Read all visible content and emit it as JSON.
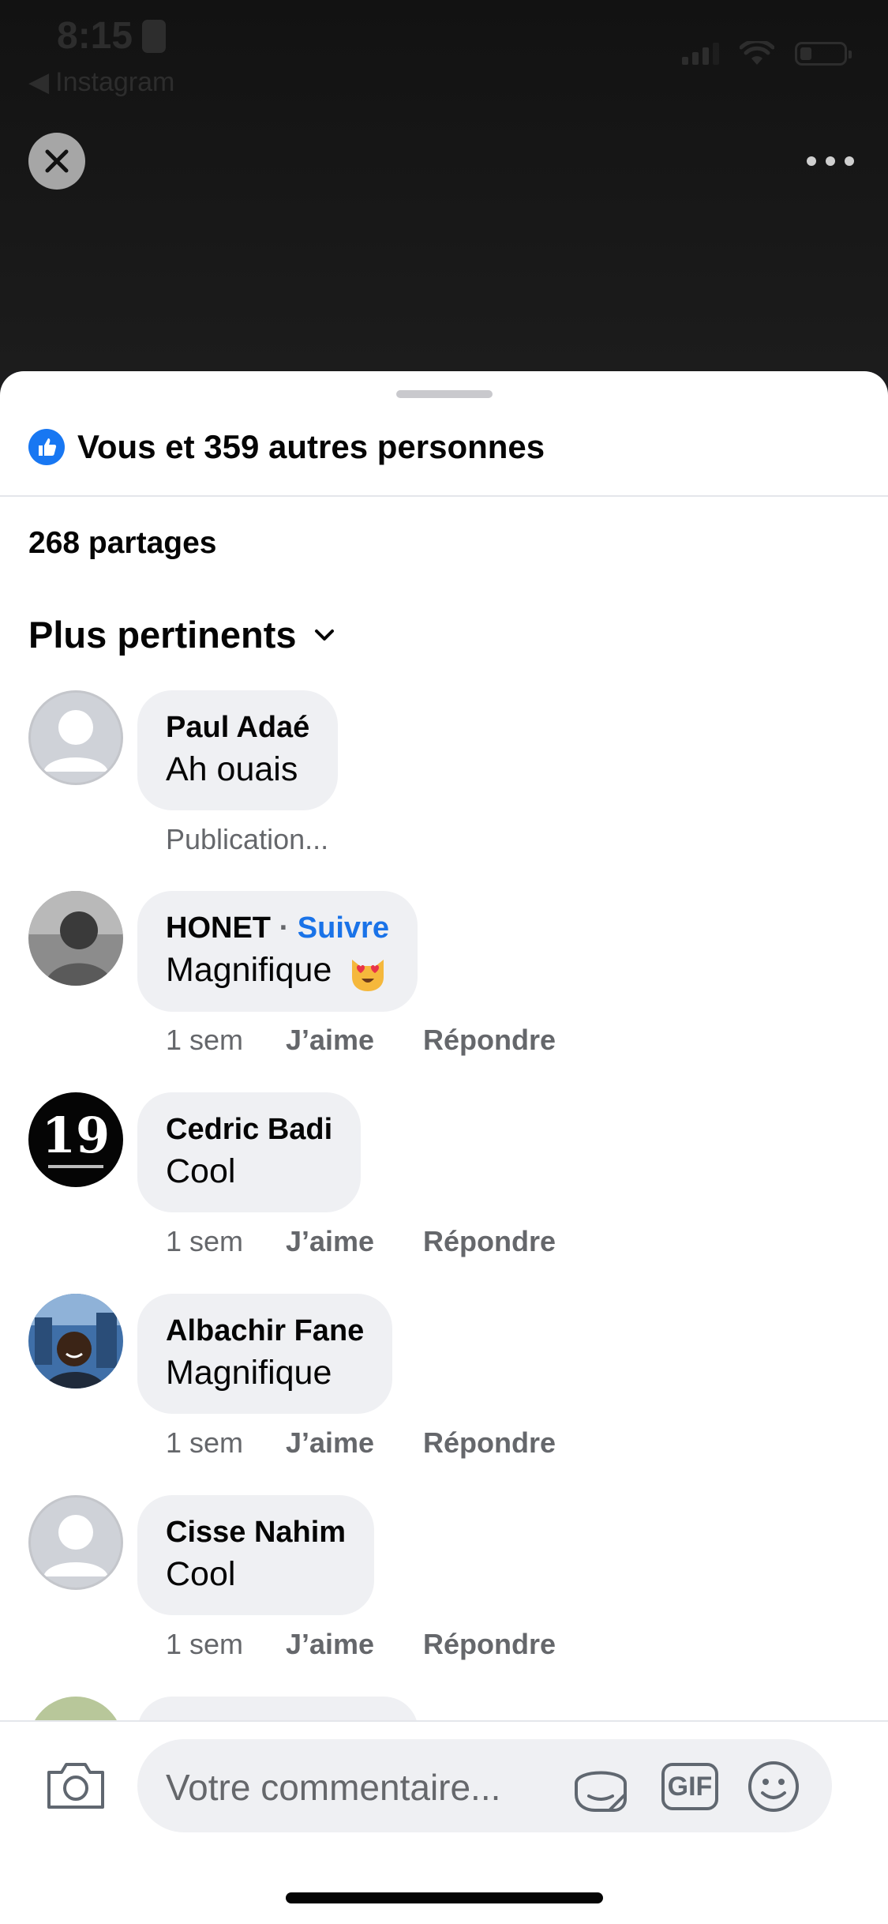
{
  "status_bar": {
    "time": "8:15",
    "back_app": "Instagram"
  },
  "top_bar": {
    "close_icon": "close-icon",
    "more_icon": "more-options-icon"
  },
  "sheet": {
    "reactions_text": "Vous et 359 autres personnes",
    "shares_text": "268 partages",
    "sort_label": "Plus pertinents"
  },
  "comments": [
    {
      "author": "Paul Adaé",
      "text": "Ah ouais",
      "status": "Publication..."
    },
    {
      "author": "HONET",
      "separator": "·",
      "follow": "Suivre",
      "text": "Magnifique",
      "time": "1 sem",
      "like": "J’aime",
      "reply": "Répondre"
    },
    {
      "author": "Cedric Badi",
      "text": "Cool",
      "avatar_text": "19",
      "time": "1 sem",
      "like": "J’aime",
      "reply": "Répondre"
    },
    {
      "author": "Albachir Fane",
      "text": "Magnifique",
      "time": "1 sem",
      "like": "J’aime",
      "reply": "Répondre"
    },
    {
      "author": "Cisse Nahim",
      "text": "Cool",
      "time": "1 sem",
      "like": "J’aime",
      "reply": "Répondre"
    }
  ],
  "input_bar": {
    "placeholder": "Votre commentaire...",
    "gif_label": "GIF"
  },
  "colors": {
    "accent": "#1877f2",
    "bubble": "#eff0f3",
    "link": "#1a73e8",
    "muted": "#65676b"
  }
}
